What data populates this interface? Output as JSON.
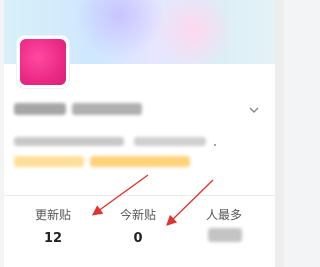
{
  "stats": [
    {
      "label": "更新贴",
      "value": "12"
    },
    {
      "label": "今新贴",
      "value": "0"
    },
    {
      "label": "人最多",
      "value": ""
    }
  ],
  "icons": {
    "chevron": "chevron-down-icon"
  },
  "colors": {
    "avatar": "#ec2a86",
    "arrow": "#e0322e",
    "tag_highlight": "#ffd27a"
  }
}
